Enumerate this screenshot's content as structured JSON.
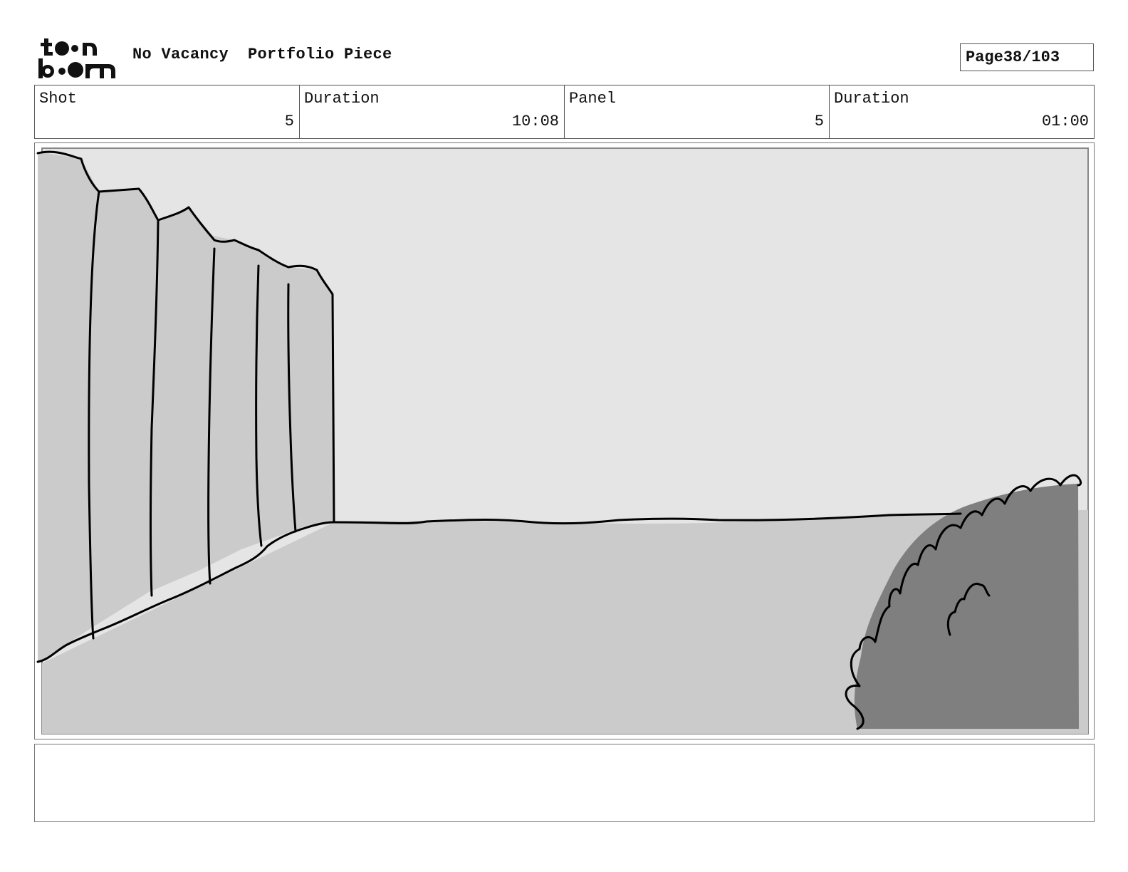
{
  "header": {
    "logo_text": "toon boom",
    "project_title": "No Vacancy  Portfolio Piece",
    "page_label": "Page",
    "page_value": "38/103"
  },
  "info": {
    "shot_label": "Shot",
    "shot_value": "5",
    "shot_duration_label": "Duration",
    "shot_duration_value": "10:08",
    "panel_label": "Panel",
    "panel_value": "5",
    "panel_duration_label": "Duration",
    "panel_duration_value": "01:00"
  },
  "colors": {
    "sky": "#e5e5e5",
    "ground": "#cbcbcb",
    "fence": "#cbcbcb",
    "bush": "#7f7f7f",
    "line": "#000000"
  },
  "notes": {
    "text": ""
  }
}
